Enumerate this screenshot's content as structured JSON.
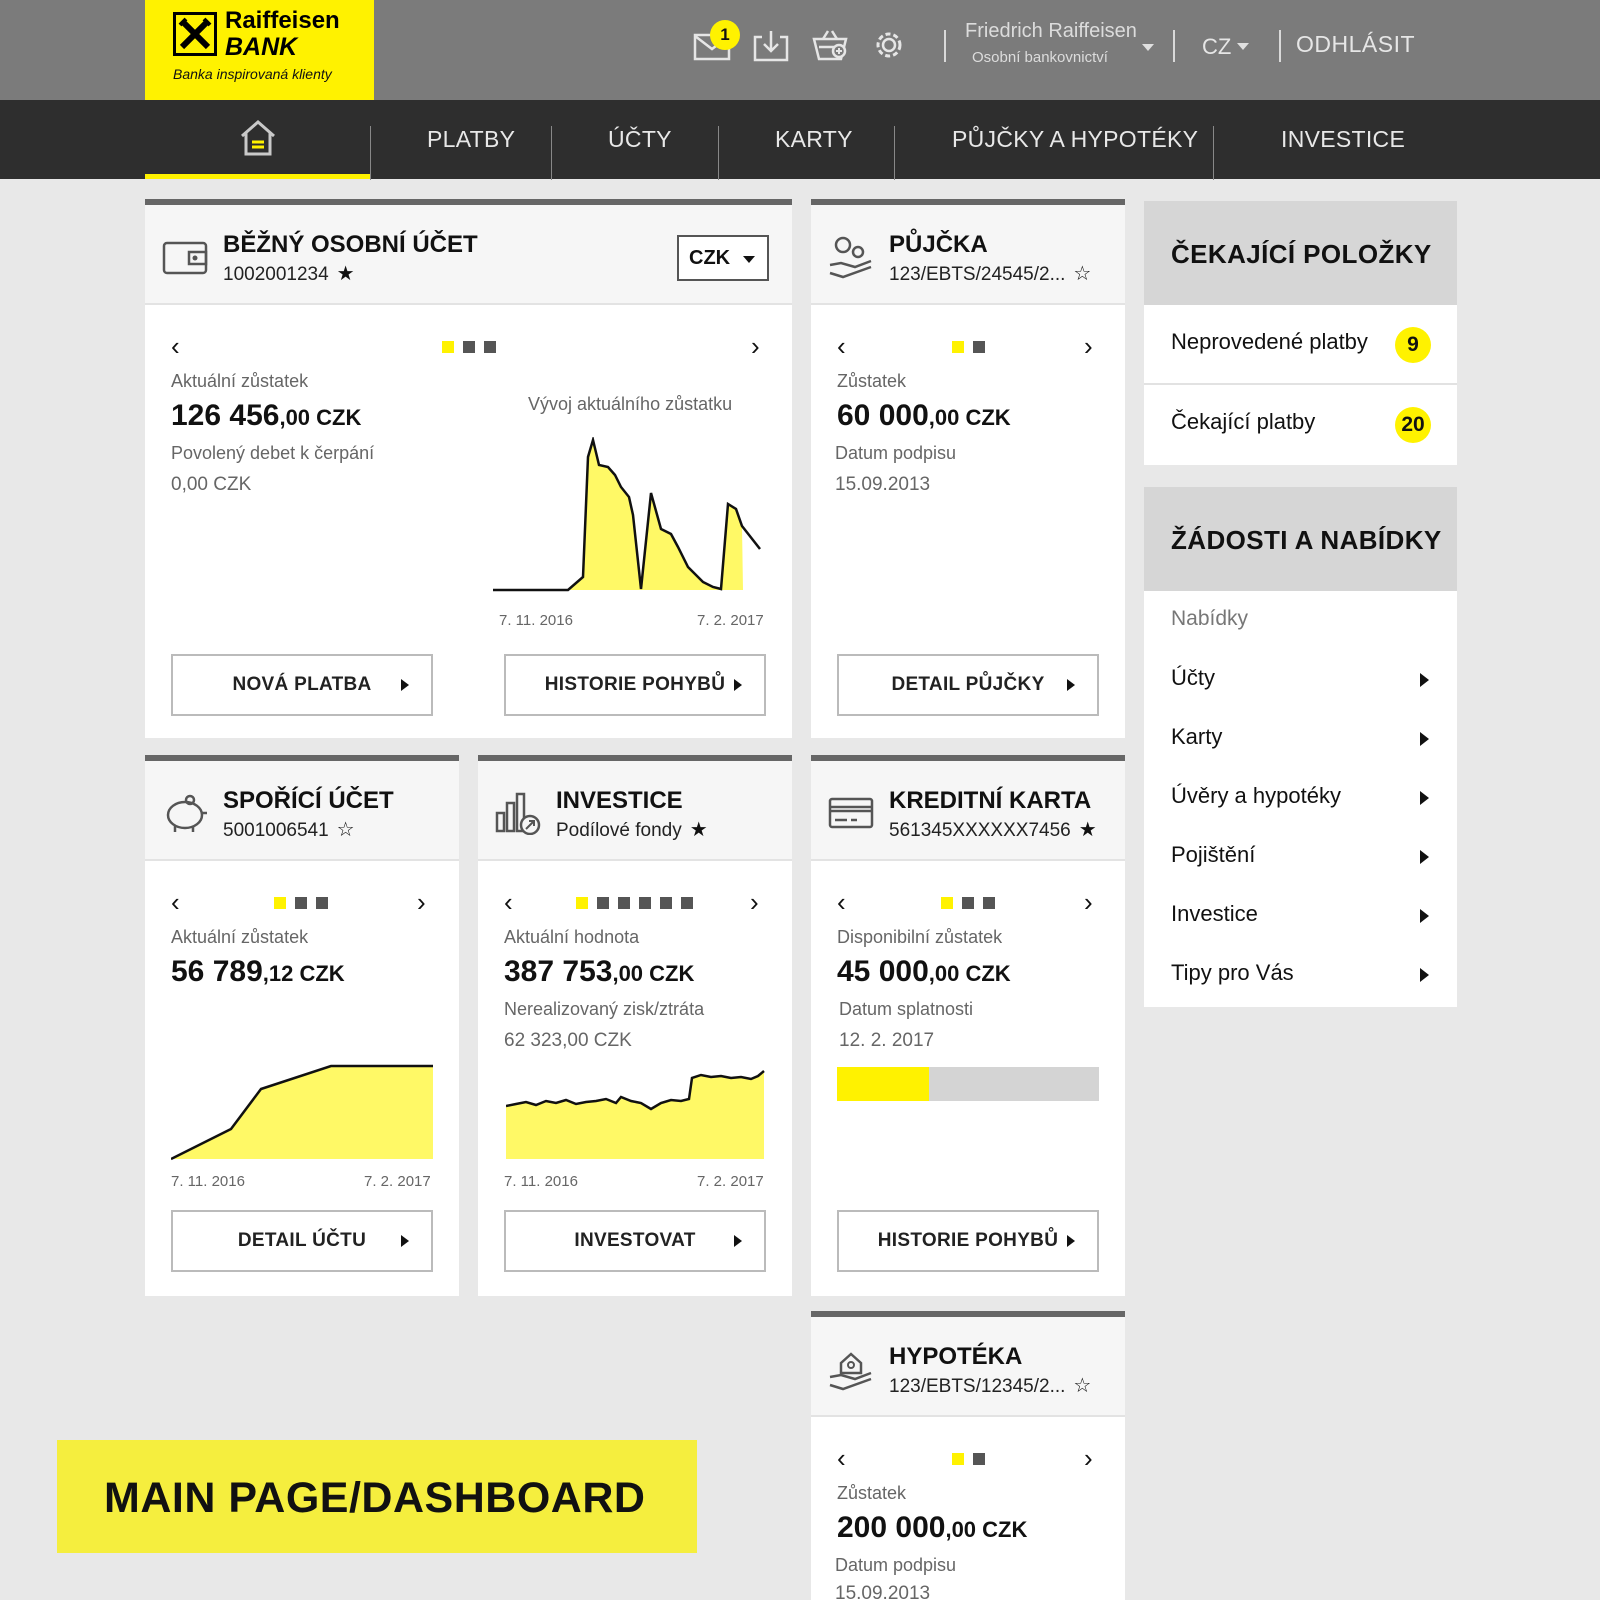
{
  "header": {
    "logo_name": "Raiffeisen",
    "logo_bank": "BANK",
    "logo_tagline": "Banka inspirovaná klienty",
    "mail_badge": "1",
    "user_name": "Friedrich Raiffeisen",
    "user_sub": "Osobní bankovnictví",
    "language": "CZ",
    "logout": "ODHLÁSIT"
  },
  "nav": {
    "items": [
      "PLATBY",
      "ÚČTY",
      "KARTY",
      "PŮJČKY A HYPOTÉKY",
      "INVESTICE"
    ]
  },
  "cards": {
    "current": {
      "title": "BĚŽNÝ OSOBNÍ ÚČET",
      "number": "1002001234",
      "star": "★",
      "currency": "CZK",
      "balance_label": "Aktuální zůstatek",
      "balance_main": "126 456",
      "balance_small": ",00 CZK",
      "overdraft_label": "Povolený debet k čerpání",
      "overdraft_value": "0,00 CZK",
      "chart_title": "Vývoj aktuálního zůstatku",
      "axis_start": "7. 11. 2016",
      "axis_end": "7. 2. 2017",
      "btn_payment": "NOVÁ PLATBA",
      "btn_history": "HISTORIE POHYBŮ"
    },
    "loan": {
      "title": "PŮJČKA",
      "number": "123/EBTS/24545/2...",
      "star": "☆",
      "balance_label": "Zůstatek",
      "balance_main": "60 000",
      "balance_small": ",00 CZK",
      "date_label": "Datum podpisu",
      "date_value": "15.09.2013",
      "btn_detail": "DETAIL PŮJČKY"
    },
    "savings": {
      "title": "SPOŘÍCÍ ÚČET",
      "number": "5001006541",
      "star": "☆",
      "balance_label": "Aktuální zůstatek",
      "balance_main": "56 789",
      "balance_small": ",12 CZK",
      "axis_start": "7. 11. 2016",
      "axis_end": "7. 2. 2017",
      "btn_detail": "DETAIL ÚČTU"
    },
    "investment": {
      "title": "INVESTICE",
      "subtitle": "Podílové fondy",
      "star": "★",
      "value_label": "Aktuální hodnota",
      "value_main": "387 753",
      "value_small": ",00 CZK",
      "gain_label": "Nerealizovaný zisk/ztráta",
      "gain_value": "62 323,00 CZK",
      "axis_start": "7. 11. 2016",
      "axis_end": "7. 2. 2017",
      "btn_invest": "INVESTOVAT"
    },
    "credit_card": {
      "title": "KREDITNÍ KARTA",
      "number": "561345XXXXXX7456",
      "star": "★",
      "balance_label": "Disponibilní zůstatek",
      "balance_main": "45 000",
      "balance_small": ",00 CZK",
      "due_label": "Datum splatnosti",
      "due_value": "12. 2. 2017",
      "progress_fraction": 0.35,
      "btn_history": "HISTORIE POHYBŮ"
    },
    "mortgage": {
      "title": "HYPOTÉKA",
      "number": "123/EBTS/12345/2...",
      "star": "☆",
      "balance_label": "Zůstatek",
      "balance_main": "200 000",
      "balance_small": ",00 CZK",
      "date_label": "Datum podpisu",
      "date_value": "15.09.2013"
    }
  },
  "pending": {
    "title": "ČEKAJÍCÍ POLOŽKY",
    "items": [
      {
        "label": "Neprovedené platby",
        "count": "9"
      },
      {
        "label": "Čekající platby",
        "count": "20"
      }
    ]
  },
  "offers": {
    "title": "ŽÁDOSTI A NABÍDKY",
    "subtitle": "Nabídky",
    "items": [
      "Účty",
      "Karty",
      "Úvěry a hypotéky",
      "Pojištění",
      "Investice",
      "Tipy pro Vás"
    ]
  },
  "banner": "MAIN PAGE/DASHBOARD",
  "colors": {
    "accent": "#fff200",
    "topbar": "#7b7b7b",
    "navbar": "#2e2e2e"
  },
  "icons": [
    "mail-icon",
    "download-icon",
    "basket-icon",
    "gear-icon",
    "home-icon",
    "wallet-icon",
    "loan-hand-icon",
    "piggy-bank-icon",
    "bar-chart-icon",
    "credit-card-icon",
    "house-hand-icon"
  ]
}
